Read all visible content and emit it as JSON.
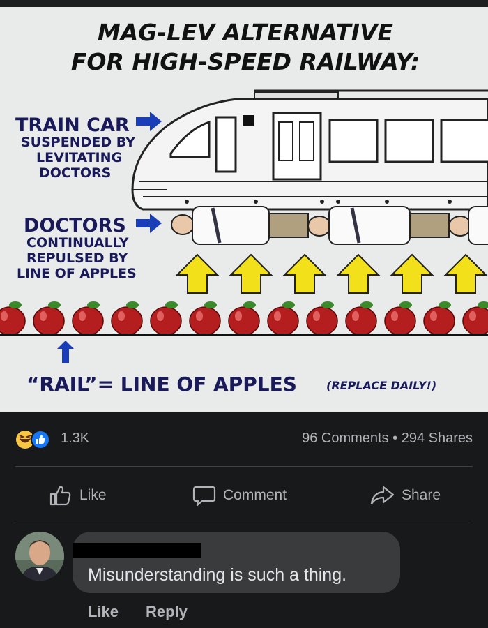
{
  "meme": {
    "title_line1": "MAG-LEV ALTERNATIVE",
    "title_line2": "FOR HIGH-SPEED RAILWAY:",
    "train_label": [
      "TRAIN CAR",
      "SUSPENDED BY",
      "LEVITATING",
      "DOCTORS"
    ],
    "doctors_label": [
      "DOCTORS",
      "CONTINUALLY",
      "REPULSED BY",
      "LINE OF APPLES"
    ],
    "rail_label": "“RAIL”= LINE OF APPLES",
    "replace_note": "(REPLACE DAILY!)",
    "colors": {
      "arrow_blue": "#1a3db8",
      "apple_red": "#b51e1e",
      "up_arrow_yellow": "#f2e01a"
    }
  },
  "post": {
    "reaction_icons": [
      "haha-icon",
      "like-icon"
    ],
    "reaction_count": "1.3K",
    "comments_shares": "96 Comments • 294 Shares"
  },
  "actions": {
    "like": "Like",
    "comment": "Comment",
    "share": "Share"
  },
  "comment": {
    "text": "Misunderstanding is such a thing.",
    "like": "Like",
    "reply": "Reply"
  }
}
